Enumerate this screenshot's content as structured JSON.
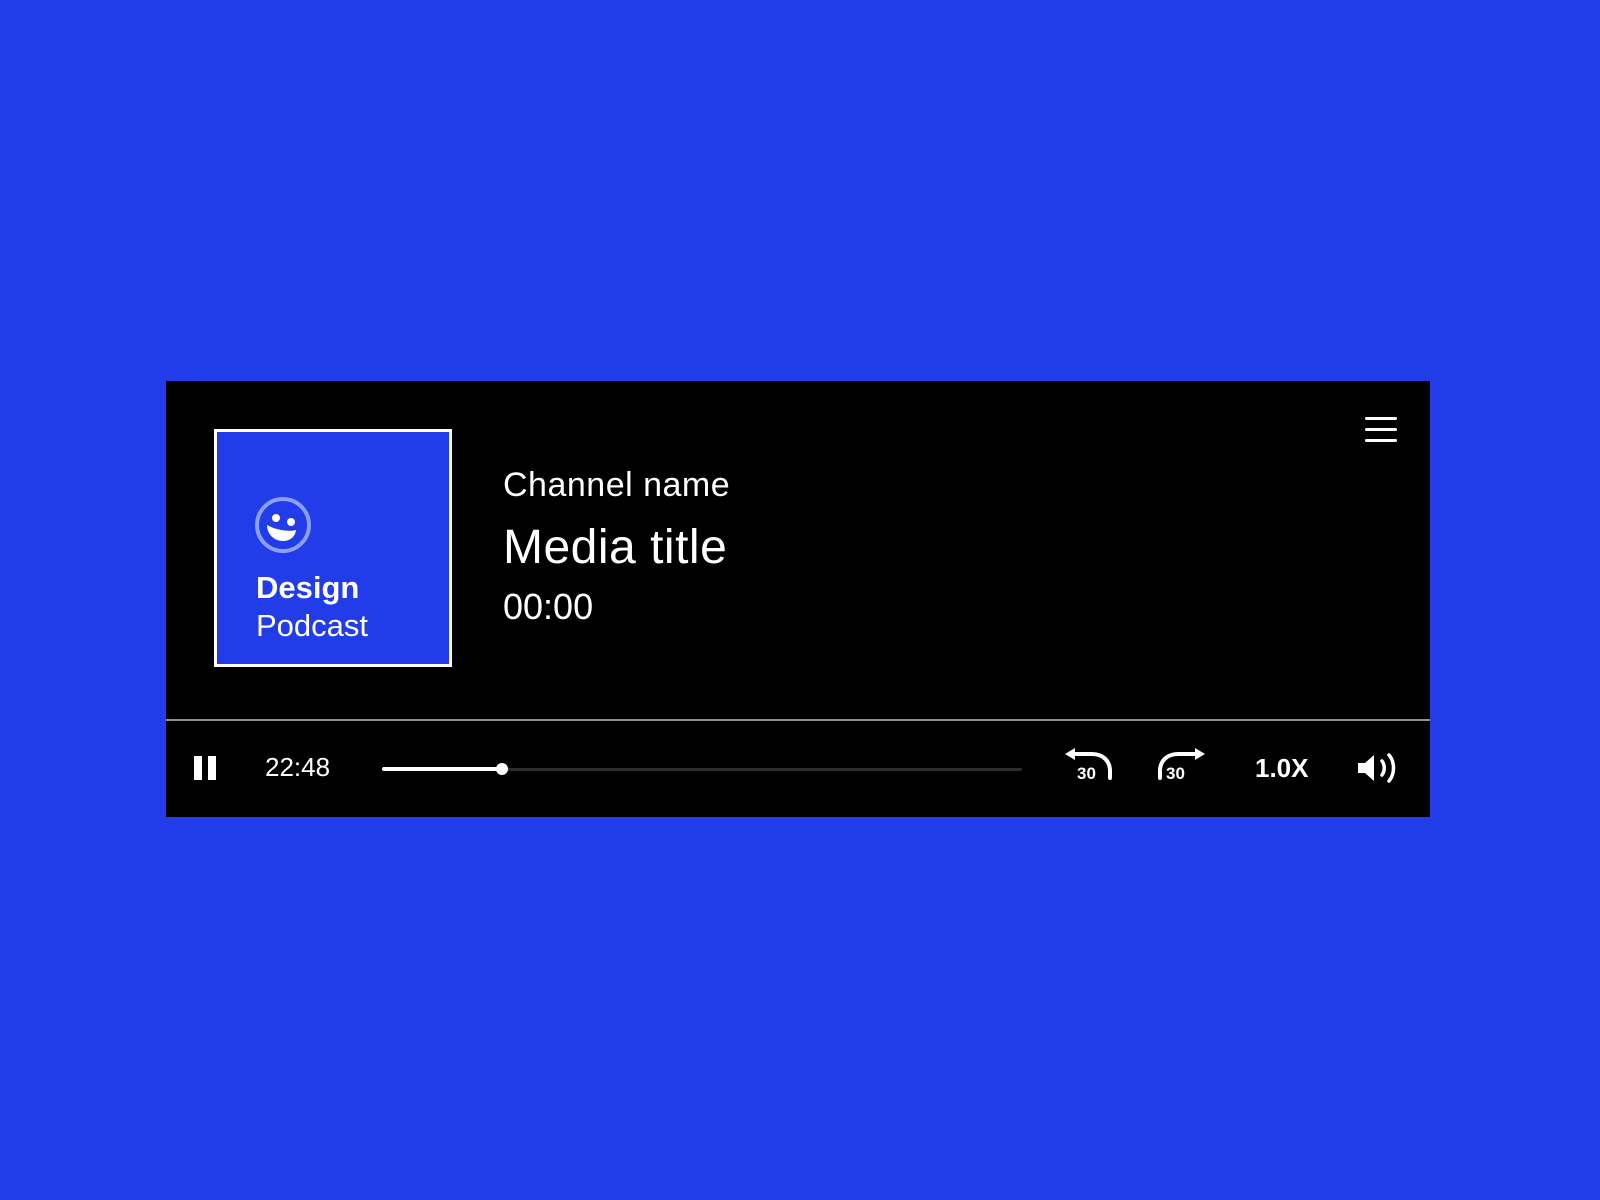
{
  "colors": {
    "background": "#213CE8",
    "player_background": "#000000",
    "accent": "#213CE8",
    "text": "#FFFFFF",
    "divider": "#8E8E8E"
  },
  "cover": {
    "logo_icon": "smile-icon",
    "title": "Design",
    "subtitle": "Podcast"
  },
  "info": {
    "channel": "Channel name",
    "title": "Media title",
    "elapsed": "00:00"
  },
  "header": {
    "menu_icon": "hamburger-menu-icon"
  },
  "controls": {
    "play_state_icon": "pause-icon",
    "time": "22:48",
    "progress": 0.188,
    "skip_back": {
      "icon": "rewind-30-icon",
      "label": "30"
    },
    "skip_forward": {
      "icon": "forward-30-icon",
      "label": "30"
    },
    "speed": "1.0X",
    "volume_icon": "volume-icon"
  }
}
